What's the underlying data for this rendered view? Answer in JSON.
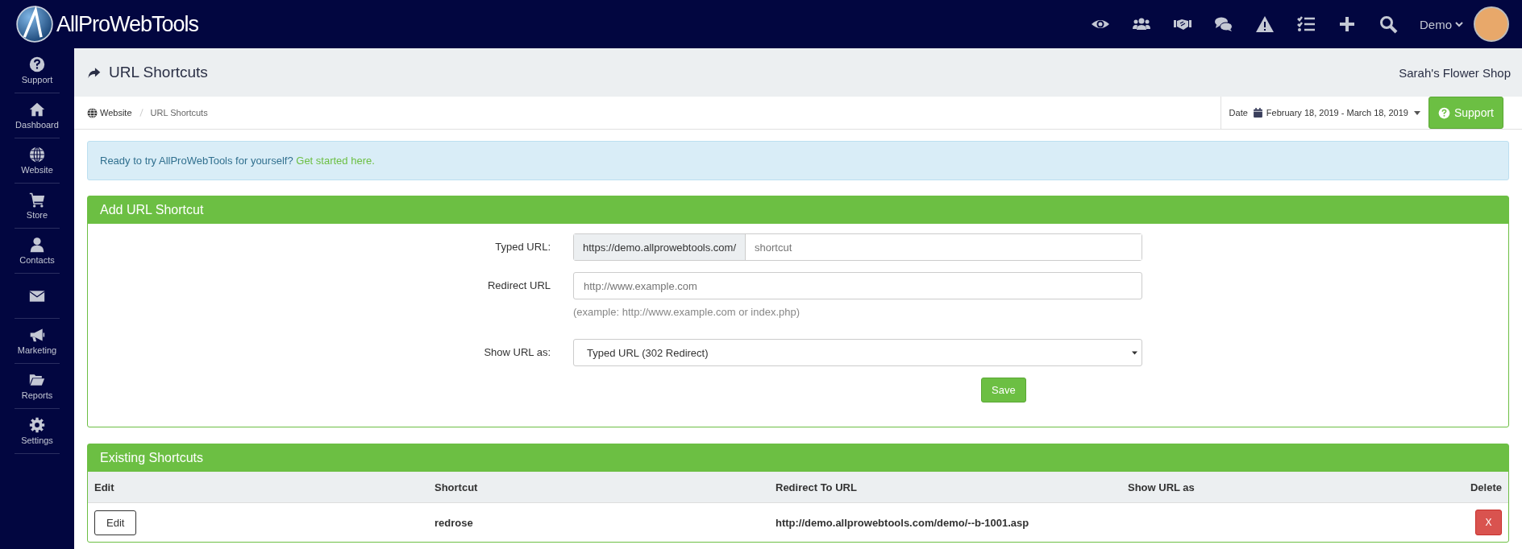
{
  "topbar": {
    "brand": "AllProWebTools",
    "user": "Demo"
  },
  "sidebar": {
    "items": [
      {
        "kind": "help",
        "label": "Support"
      },
      {
        "kind": "home",
        "label": "Dashboard"
      },
      {
        "kind": "globe",
        "label": "Website"
      },
      {
        "kind": "cart",
        "label": "Store"
      },
      {
        "kind": "person",
        "label": "Contacts"
      },
      {
        "kind": "mail"
      },
      {
        "kind": "megaphone",
        "label": "Marketing"
      },
      {
        "kind": "folder",
        "label": "Reports"
      },
      {
        "kind": "settings",
        "label": "Settings"
      }
    ]
  },
  "header": {
    "title": "URL Shortcuts",
    "account": "Sarah's Flower Shop"
  },
  "breadcrumb": [
    "Website",
    "URL Shortcuts"
  ],
  "date": {
    "label": "Date",
    "range": "February 18, 2019 - March 18, 2019"
  },
  "support_button": "Support",
  "alert": {
    "text": "Ready to try AllProWebTools for yourself?",
    "link": "Get started here."
  },
  "add_panel": {
    "title": "Add URL Shortcut",
    "typed_url": {
      "label": "Typed URL:",
      "prefix": "https://demo.allprowebtools.com/",
      "placeholder": "shortcut"
    },
    "redirect_url": {
      "label": "Redirect URL",
      "placeholder": "http://www.example.com",
      "help": "(example: http://www.example.com or index.php)"
    },
    "show_as": {
      "label": "Show URL as:",
      "value": "Typed URL (302 Redirect)"
    },
    "save": "Save"
  },
  "existing_panel": {
    "title": "Existing Shortcuts",
    "columns": [
      "Edit",
      "Shortcut",
      "Redirect To URL",
      "Show URL as",
      "Delete"
    ],
    "rows": [
      {
        "edit": "Edit",
        "shortcut": "redrose",
        "redirect": "http://demo.allprowebtools.com/demo/--b-1001.asp",
        "delete": "X"
      }
    ]
  }
}
